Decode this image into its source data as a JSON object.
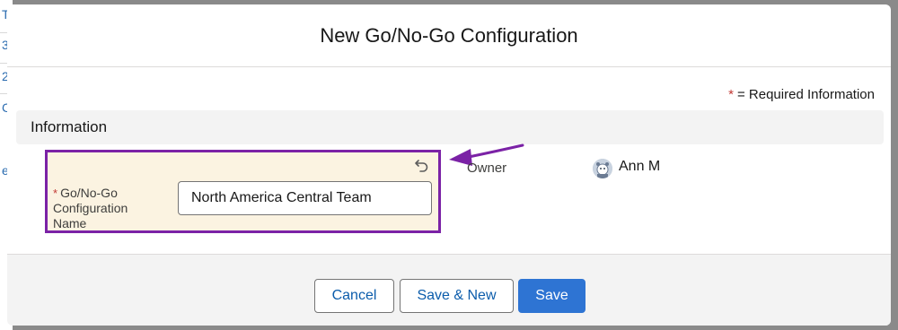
{
  "background": {
    "fragments": [
      "T",
      "3",
      "2",
      "C",
      "e"
    ]
  },
  "modal": {
    "title": "New Go/No-Go Configuration",
    "required_note": {
      "star": "*",
      "text": "= Required Information"
    },
    "section": {
      "title": "Information"
    },
    "name_field": {
      "required_star": "*",
      "label_line1": "Go/No-Go",
      "label_line2": "Configuration",
      "label_line3": "Name",
      "value": "North America Central Team",
      "undo_icon": "undo-icon"
    },
    "owner": {
      "label": "Owner",
      "name": "Ann M",
      "avatar_icon": "user-avatar-icon"
    },
    "footer": {
      "cancel_label": "Cancel",
      "save_new_label": "Save & New",
      "save_label": "Save"
    }
  },
  "colors": {
    "highlight_border": "#7b22a6",
    "field_background": "#fbf3e1",
    "brand_button": "#2e74d3",
    "required_star": "#c23934"
  }
}
